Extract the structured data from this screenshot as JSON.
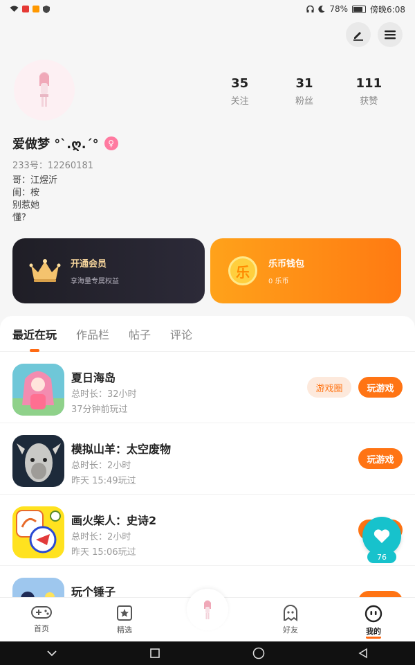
{
  "status_bar": {
    "battery": "78%",
    "time": "傍晚6:08"
  },
  "profile": {
    "nickname": "爱做梦 °ˋ.ღ.ˊ°",
    "gender_symbol": "♀",
    "uid_label": "233号：12260181",
    "bio_lines": [
      "哥：江煜沂",
      "闺：桉",
      "别惹她",
      "懂?"
    ],
    "stats": [
      {
        "num": "35",
        "label": "关注"
      },
      {
        "num": "31",
        "label": "粉丝"
      },
      {
        "num": "111",
        "label": "获赞"
      }
    ]
  },
  "cards": {
    "vip": {
      "title": "开通会员",
      "subtitle": "享海量专属权益"
    },
    "wallet": {
      "title": "乐币钱包",
      "subtitle": "0 乐币",
      "icon_char": "乐"
    }
  },
  "tabs": [
    "最近在玩",
    "作品栏",
    "帖子",
    "评论"
  ],
  "games": [
    {
      "name": "夏日海岛",
      "duration": "总时长：32小时",
      "last": "37分钟前玩过",
      "circle_label": "游戏圈",
      "play_label": "玩游戏"
    },
    {
      "name": "模拟山羊：太空废物",
      "duration": "总时长：2小时",
      "last": "昨天 15:49玩过",
      "play_label": "玩游戏"
    },
    {
      "name": "画火柴人：史诗2",
      "duration": "总时长：2小时",
      "last": "昨天 15:06玩过",
      "play_label": "玩游戏"
    },
    {
      "name": "玩个锤子",
      "duration": "",
      "last": "",
      "play_label": "玩游戏"
    }
  ],
  "float_like": {
    "count": "76"
  },
  "bottom_nav": [
    {
      "label": "首页",
      "icon": "gamepad-icon"
    },
    {
      "label": "精选",
      "icon": "star-box-icon"
    },
    {
      "label": "",
      "icon": "avatar-icon"
    },
    {
      "label": "好友",
      "icon": "ghost-icon"
    },
    {
      "label": "我的",
      "icon": "face-icon"
    }
  ],
  "colors": {
    "accent": "#ff7414",
    "like": "#17c2cc"
  }
}
